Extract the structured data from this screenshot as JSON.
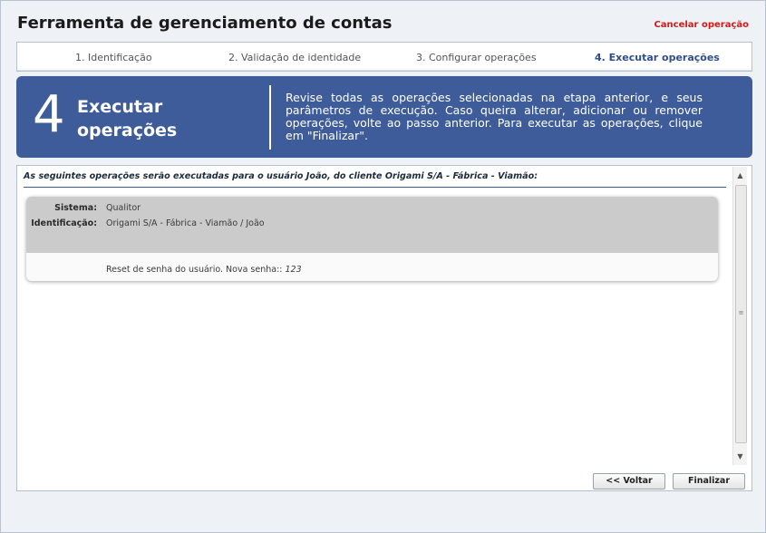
{
  "app": {
    "title": "Ferramenta de gerenciamento de contas",
    "cancel_label": "Cancelar operação"
  },
  "steps": [
    {
      "label": "1. Identificação",
      "active": false
    },
    {
      "label": "2. Validação de identidade",
      "active": false
    },
    {
      "label": "3. Configurar operações",
      "active": false
    },
    {
      "label": "4. Executar operações",
      "active": true
    }
  ],
  "banner": {
    "number": "4",
    "heading": "Executar operações",
    "description": "Revise todas as operações selecionadas na etapa anterior, e seus parâmetros de execução. Caso queira alterar, adicionar ou remover operações, volte ao passo anterior. Para executar as operações, clique em \"Finalizar\"."
  },
  "panel": {
    "intro": "As seguintes operações serão executadas para o usuário João, do cliente Origami S/A - Fábrica - Viamão:",
    "card": {
      "sistema_label": "Sistema:",
      "sistema_value": "Qualitor",
      "ident_label": "Identificação:",
      "ident_value": "Origami S/A - Fábrica - Viamão / João",
      "operation_text": "Reset de senha do usuário. Nova senha::",
      "operation_value": "123"
    }
  },
  "buttons": {
    "back": "<< Voltar",
    "finish": "Finalizar"
  },
  "colors": {
    "banner_bg": "#3d5c99",
    "cancel": "#d11a1a",
    "active_step": "#2e4e8e"
  }
}
